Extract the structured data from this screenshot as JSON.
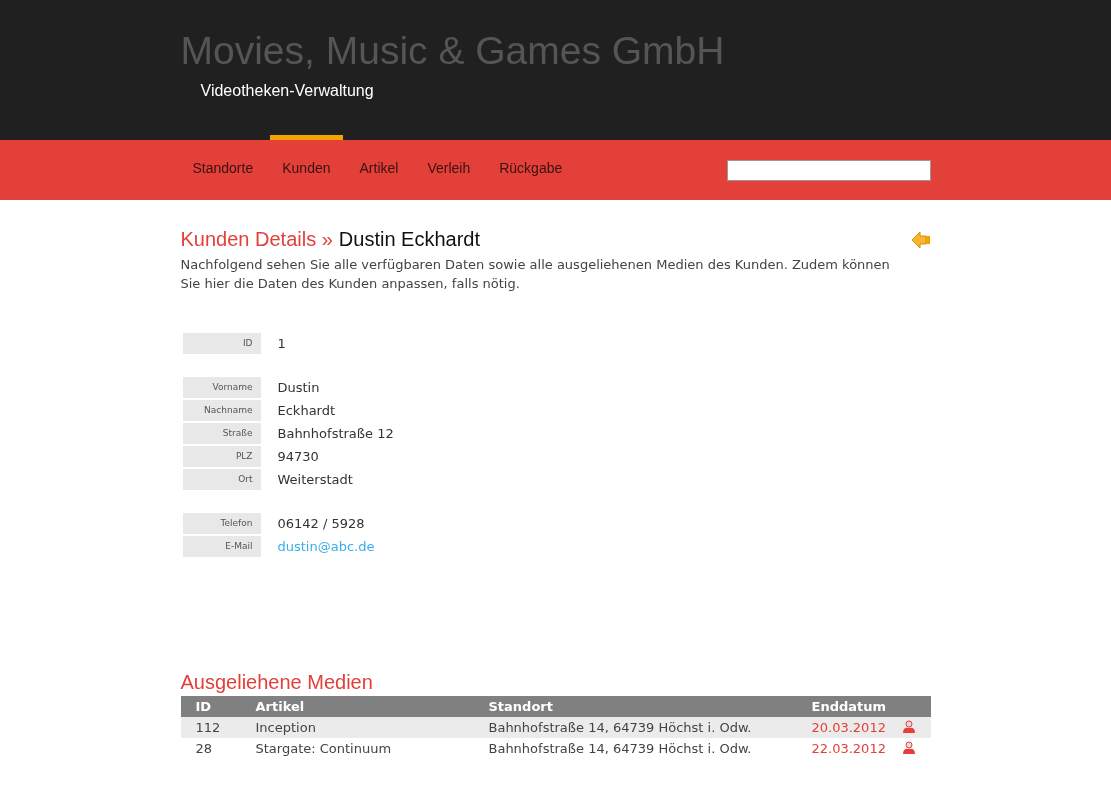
{
  "header": {
    "title": "Movies, Music & Games GmbH",
    "subtitle": "Videotheken-Verwaltung"
  },
  "nav": [
    {
      "label": "Standorte",
      "selected": false
    },
    {
      "label": "Kunden",
      "selected": true
    },
    {
      "label": "Artikel",
      "selected": false
    },
    {
      "label": "Verleih",
      "selected": false
    },
    {
      "label": "Rückgabe",
      "selected": false
    }
  ],
  "page": {
    "breadcrumb": "Kunden Details »",
    "name": "Dustin Eckhardt",
    "description": "Nachfolgend sehen Sie alle verfügbaren Daten sowie alle ausgeliehenen Medien des Kunden. Zudem können Sie hier die Daten des Kunden anpassen, falls nötig."
  },
  "field_groups": [
    [
      {
        "label": "ID",
        "value": "1",
        "kind": "text"
      }
    ],
    [
      {
        "label": "Vorname",
        "value": "Dustin",
        "kind": "text"
      },
      {
        "label": "Nachname",
        "value": "Eckhardt",
        "kind": "text"
      },
      {
        "label": "Straße",
        "value": "Bahnhofstraße 12",
        "kind": "text"
      },
      {
        "label": "PLZ",
        "value": "94730",
        "kind": "text"
      },
      {
        "label": "Ort",
        "value": "Weiterstadt",
        "kind": "text"
      }
    ],
    [
      {
        "label": "Telefon",
        "value": "06142 / 5928",
        "kind": "text"
      },
      {
        "label": "E-Mail",
        "value": "dustin@abc.de",
        "kind": "link"
      }
    ]
  ],
  "media": {
    "title": "Ausgeliehene Medien",
    "columns": [
      "ID",
      "Artikel",
      "Standort",
      "Enddatum"
    ],
    "rows": [
      {
        "id": "112",
        "article": "Inception",
        "location": "Bahnhofstraße 14, 64739 Höchst i. Odw.",
        "end_date": "20.03.2012"
      },
      {
        "id": "28",
        "article": "Stargate: Continuum",
        "location": "Bahnhofstraße 14, 64739 Höchst i. Odw.",
        "end_date": "22.03.2012"
      }
    ]
  }
}
